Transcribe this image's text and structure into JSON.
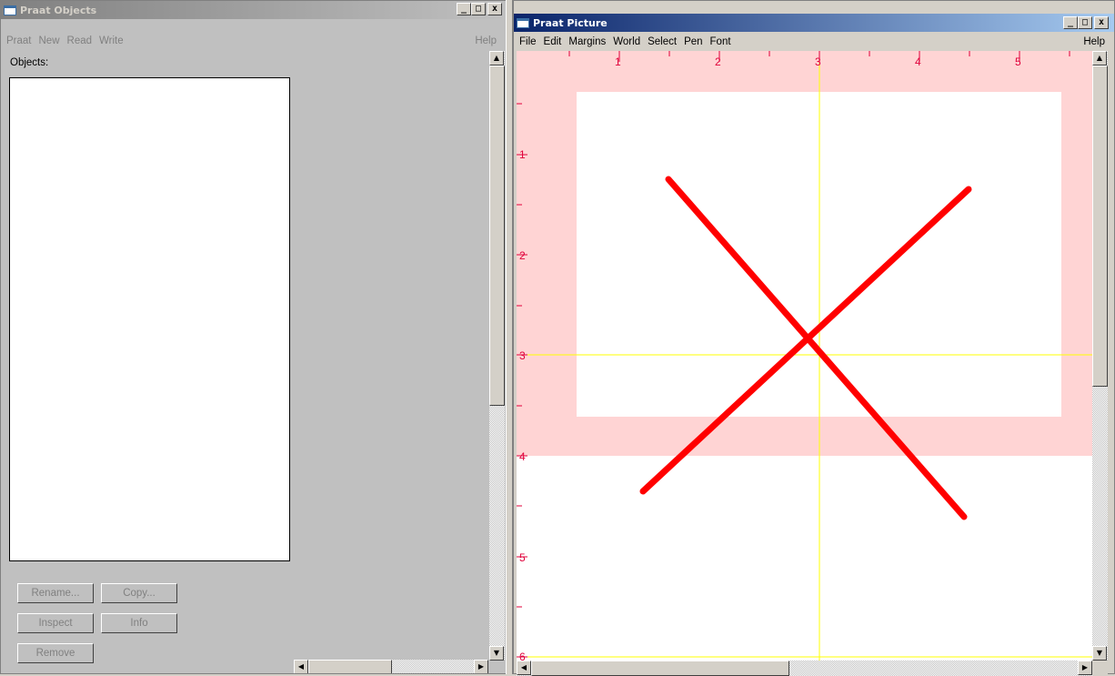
{
  "objects_window": {
    "title": "Praat Objects",
    "menu": [
      "Praat",
      "New",
      "Read",
      "Write"
    ],
    "help": "Help",
    "objects_label": "Objects:",
    "buttons": {
      "rename": "Rename...",
      "copy": "Copy...",
      "inspect": "Inspect",
      "info": "Info",
      "remove": "Remove"
    }
  },
  "picture_window": {
    "title": "Praat Picture",
    "menu": [
      "File",
      "Edit",
      "Margins",
      "World",
      "Select",
      "Pen",
      "Font"
    ],
    "help": "Help",
    "x_ruler_labels": [
      "1",
      "2",
      "3",
      "4",
      "5"
    ],
    "y_ruler_labels": [
      "1",
      "2",
      "3",
      "4",
      "5",
      "6"
    ],
    "colors": {
      "selection": "#ffd4d4",
      "drawing": "#ff0000",
      "crosshair": "#ffff00",
      "ruler": "#e0003a"
    }
  },
  "window_buttons": {
    "minimize": "_",
    "maximize": "□",
    "close": "x"
  }
}
